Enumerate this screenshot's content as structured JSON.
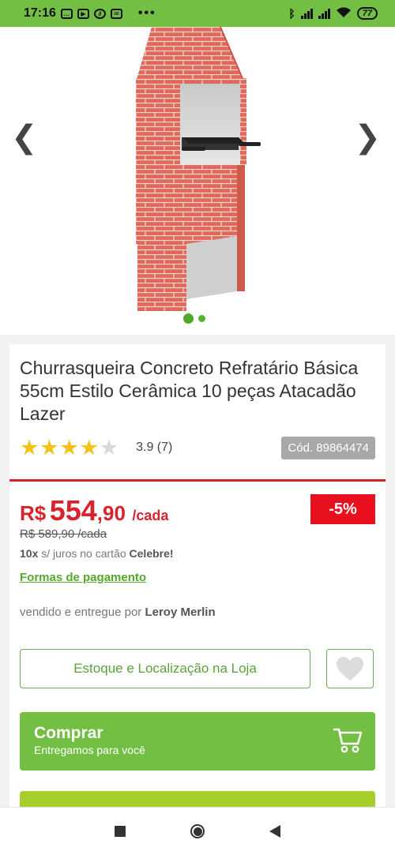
{
  "status_bar": {
    "time": "17:16",
    "battery": "77",
    "icons": [
      "messenger-icon",
      "youtube-icon",
      "leaf-icon",
      "mail-icon",
      "more-dots-icon",
      "bluetooth-icon",
      "signal-icon",
      "signal-icon",
      "wifi-icon",
      "battery-icon"
    ]
  },
  "gallery": {
    "prev_icon": "❮",
    "next_icon": "❯",
    "image_count": 2,
    "active_index": 0
  },
  "product": {
    "title": "Churrasqueira Concreto Refratário Básica 55cm Estilo Cerâmica 10 peças Atacadão Lazer",
    "rating_value": 3.9,
    "rating_text": "3.9 (7)",
    "code": "Cód. 89864474"
  },
  "price": {
    "currency": "R$",
    "integer": "554",
    "cents": ",90",
    "unit": "/cada",
    "old_price": "R$ 589,90 /cada",
    "discount": "-5%",
    "installments_prefix": "10x",
    "installments_text": " s/ juros no cartão ",
    "installments_card": "Celebre!",
    "payment_link": "Formas de pagamento"
  },
  "seller": {
    "prefix": "vendido e entregue por ",
    "name": "Leroy Merlin"
  },
  "actions": {
    "stock_label": "Estoque e Localização na Loja",
    "buy_label": "Comprar",
    "buy_sublabel": "Entregamos para você"
  },
  "colors": {
    "brand_green": "#72bf44",
    "price_red": "#d8232a",
    "discount_red": "#e8101e",
    "star_yellow": "#f2c315",
    "lime": "#a6cf2c"
  }
}
